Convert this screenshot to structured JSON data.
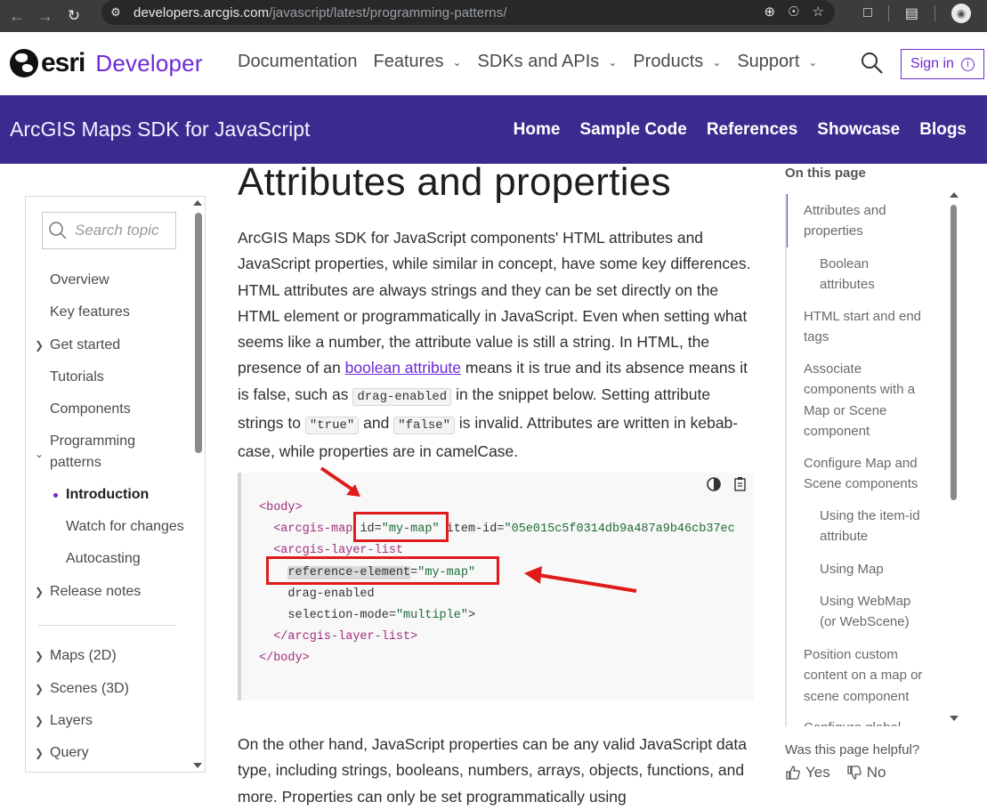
{
  "browser": {
    "url_domain": "developers.arcgis.com",
    "url_path": "/javascript/latest/programming-patterns/"
  },
  "topnav": {
    "brand": "esri",
    "product": "Developer",
    "menu": [
      {
        "label": "Documentation",
        "has_caret": false
      },
      {
        "label": "Features",
        "has_caret": true
      },
      {
        "label": "SDKs and APIs",
        "has_caret": true
      },
      {
        "label": "Products",
        "has_caret": true
      },
      {
        "label": "Support",
        "has_caret": true
      }
    ],
    "signin_label": "Sign in"
  },
  "productbar": {
    "title": "ArcGIS Maps SDK for JavaScript",
    "links": [
      "Home",
      "Sample Code",
      "References",
      "Showcase",
      "Blogs"
    ]
  },
  "sidebar": {
    "search_placeholder": "Search topic",
    "items": [
      "Overview",
      "Key features",
      "Get started",
      "Tutorials",
      "Components",
      "Programming patterns",
      "Introduction",
      "Watch for changes",
      "Autocasting",
      "Release notes",
      "Maps (2D)",
      "Scenes (3D)",
      "Layers",
      "Query"
    ]
  },
  "main": {
    "title": "Attributes and properties",
    "p1_a": "ArcGIS Maps SDK for JavaScript components' HTML attributes and JavaScript properties, while similar in concept, have some key differences. HTML attributes are always strings and they can be set directly on the HTML element or programmatically in JavaScript. Even when setting what seems like a number, the attribute value is still a string. In HTML, the presence of an ",
    "p1_link": "boolean attribute",
    "p1_b": " means it is true and its absence means it is false, such as ",
    "p1_code1": "drag-enabled",
    "p1_c": " in the snippet below. Setting attribute strings to ",
    "p1_code2": "\"true\"",
    "p1_d": " and ",
    "p1_code3": "\"false\"",
    "p1_e": " is invalid. Attributes are written in kebab-case, while properties are in camelCase.",
    "code": {
      "l1": "<body>",
      "l2_tag": "<arcgis-map",
      "l2_attr1": "id",
      "l2_val1": "\"my-map\"",
      "l2_attr2": "item-id",
      "l2_val2": "\"05e015c5f0314db9a487a9b46cb37ec",
      "l3": "<arcgis-layer-list",
      "l4_attr": "reference-element",
      "l4_val": "\"my-map\"",
      "l5": "drag-enabled",
      "l6_attr": "selection-mode",
      "l6_val": "\"multiple\"",
      "l6_end": ">",
      "l7": "</arcgis-layer-list>",
      "l8": "</body>"
    },
    "p2": "On the other hand, JavaScript properties can be any valid JavaScript data type, including strings, booleans, numbers, arrays, objects, functions, and more. Properties can only be set programmatically using"
  },
  "toc": {
    "title": "On this page",
    "items": [
      "Attributes and properties",
      "Boolean attributes",
      "HTML start and end tags",
      "Associate components with a Map or Scene component",
      "Configure Map and Scene components",
      "Using the item-id attribute",
      "Using Map",
      "Using WebMap (or WebScene)",
      "Position custom content on a map or scene component",
      "Configure global..."
    ]
  },
  "feedback": {
    "question": "Was this page helpful?",
    "yes": "Yes",
    "no": "No"
  },
  "colors": {
    "brand_purple": "#6e2ad6",
    "productbar_bg": "#3d2a8f",
    "annotation_red": "#e01b1b"
  }
}
